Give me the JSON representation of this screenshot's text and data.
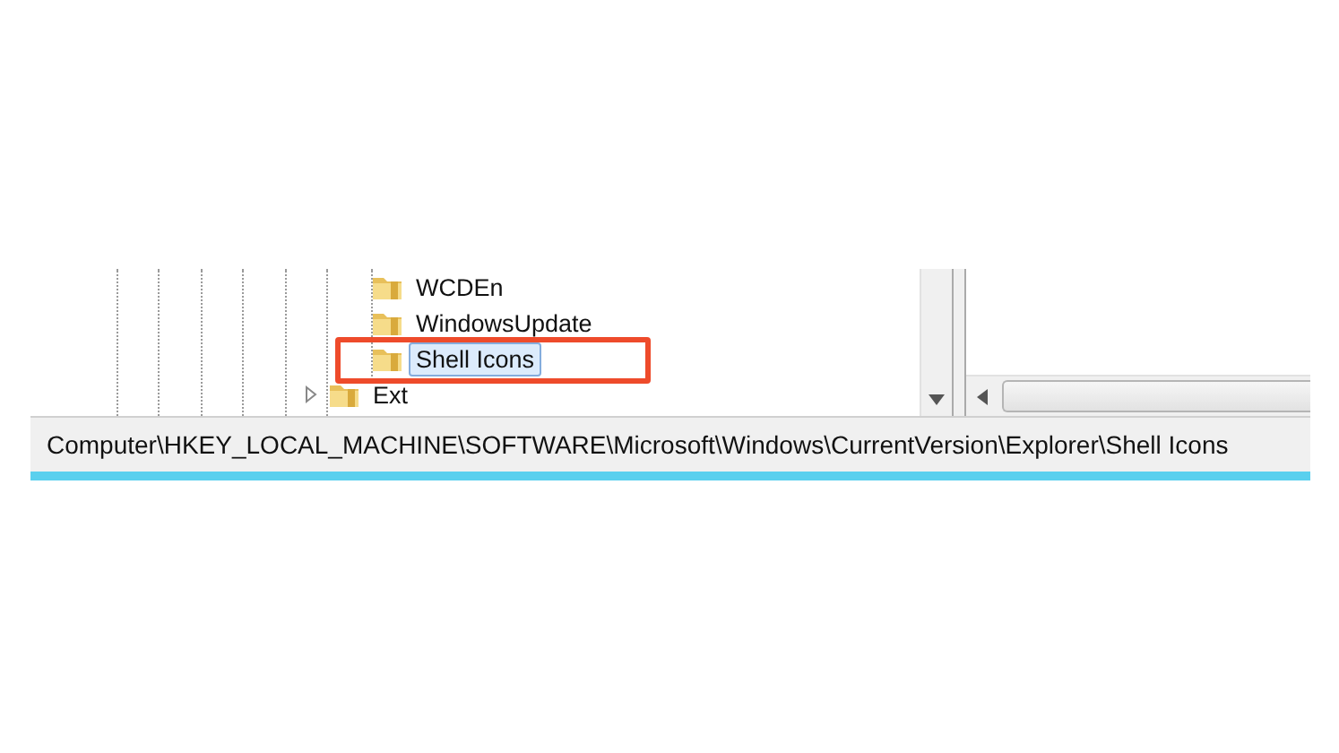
{
  "tree": [
    {
      "children": [
        {
          "label": "WCDEn",
          "selected": false,
          "annotated": false
        },
        {
          "label": "WindowsUpdate",
          "selected": false,
          "annotated": false
        },
        {
          "label": "Shell Icons",
          "selected": true,
          "annotated": true
        }
      ]
    },
    {
      "label": "Ext",
      "expanded": false,
      "selected": false,
      "annotated": false
    }
  ],
  "status_bar": "Computer\\HKEY_LOCAL_MACHINE\\SOFTWARE\\Microsoft\\Windows\\CurrentVersion\\Explorer\\Shell Icons"
}
